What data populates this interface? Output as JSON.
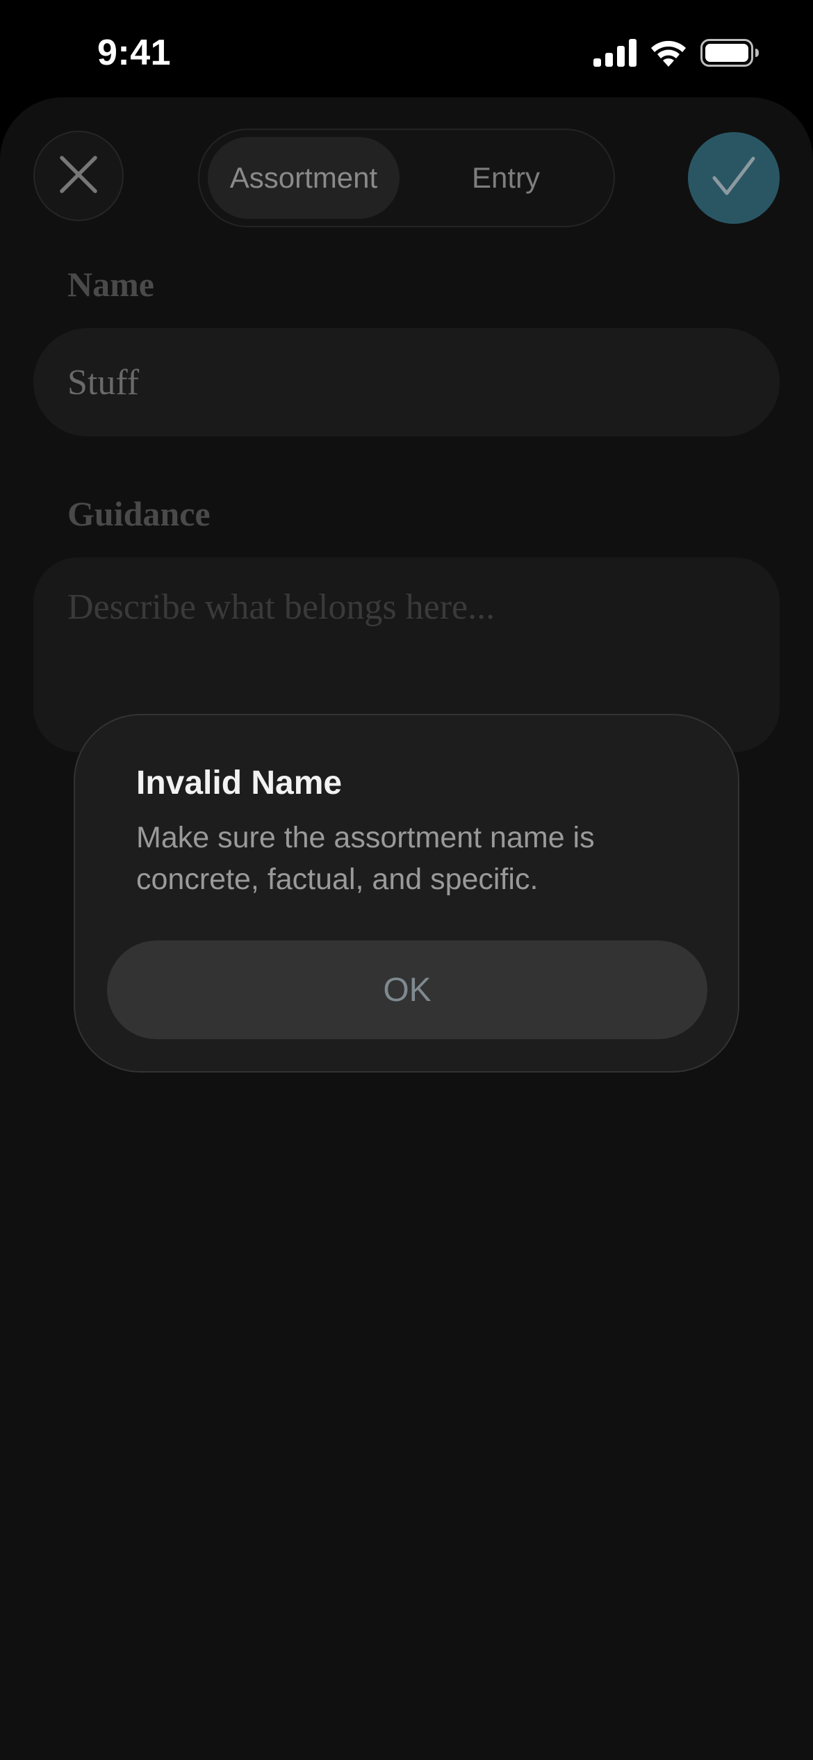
{
  "status_bar": {
    "time": "9:41",
    "icons": [
      "cellular-signal-icon",
      "wifi-icon",
      "battery-icon"
    ]
  },
  "header": {
    "close_icon": "close-icon",
    "tabs": [
      {
        "label": "Assortment",
        "selected": true
      },
      {
        "label": "Entry",
        "selected": false
      }
    ],
    "confirm_icon": "checkmark-icon"
  },
  "form": {
    "name_label": "Name",
    "name_value": "Stuff",
    "guidance_label": "Guidance",
    "guidance_placeholder": "Describe what belongs here..."
  },
  "alert": {
    "title": "Invalid Name",
    "message": "Make sure the assortment name is concrete, factual, and specific.",
    "ok_label": "OK"
  },
  "colors": {
    "background": "#000000",
    "sheet": "#101010",
    "accent": "#2a5664",
    "alert_background": "#1d1d1d"
  }
}
